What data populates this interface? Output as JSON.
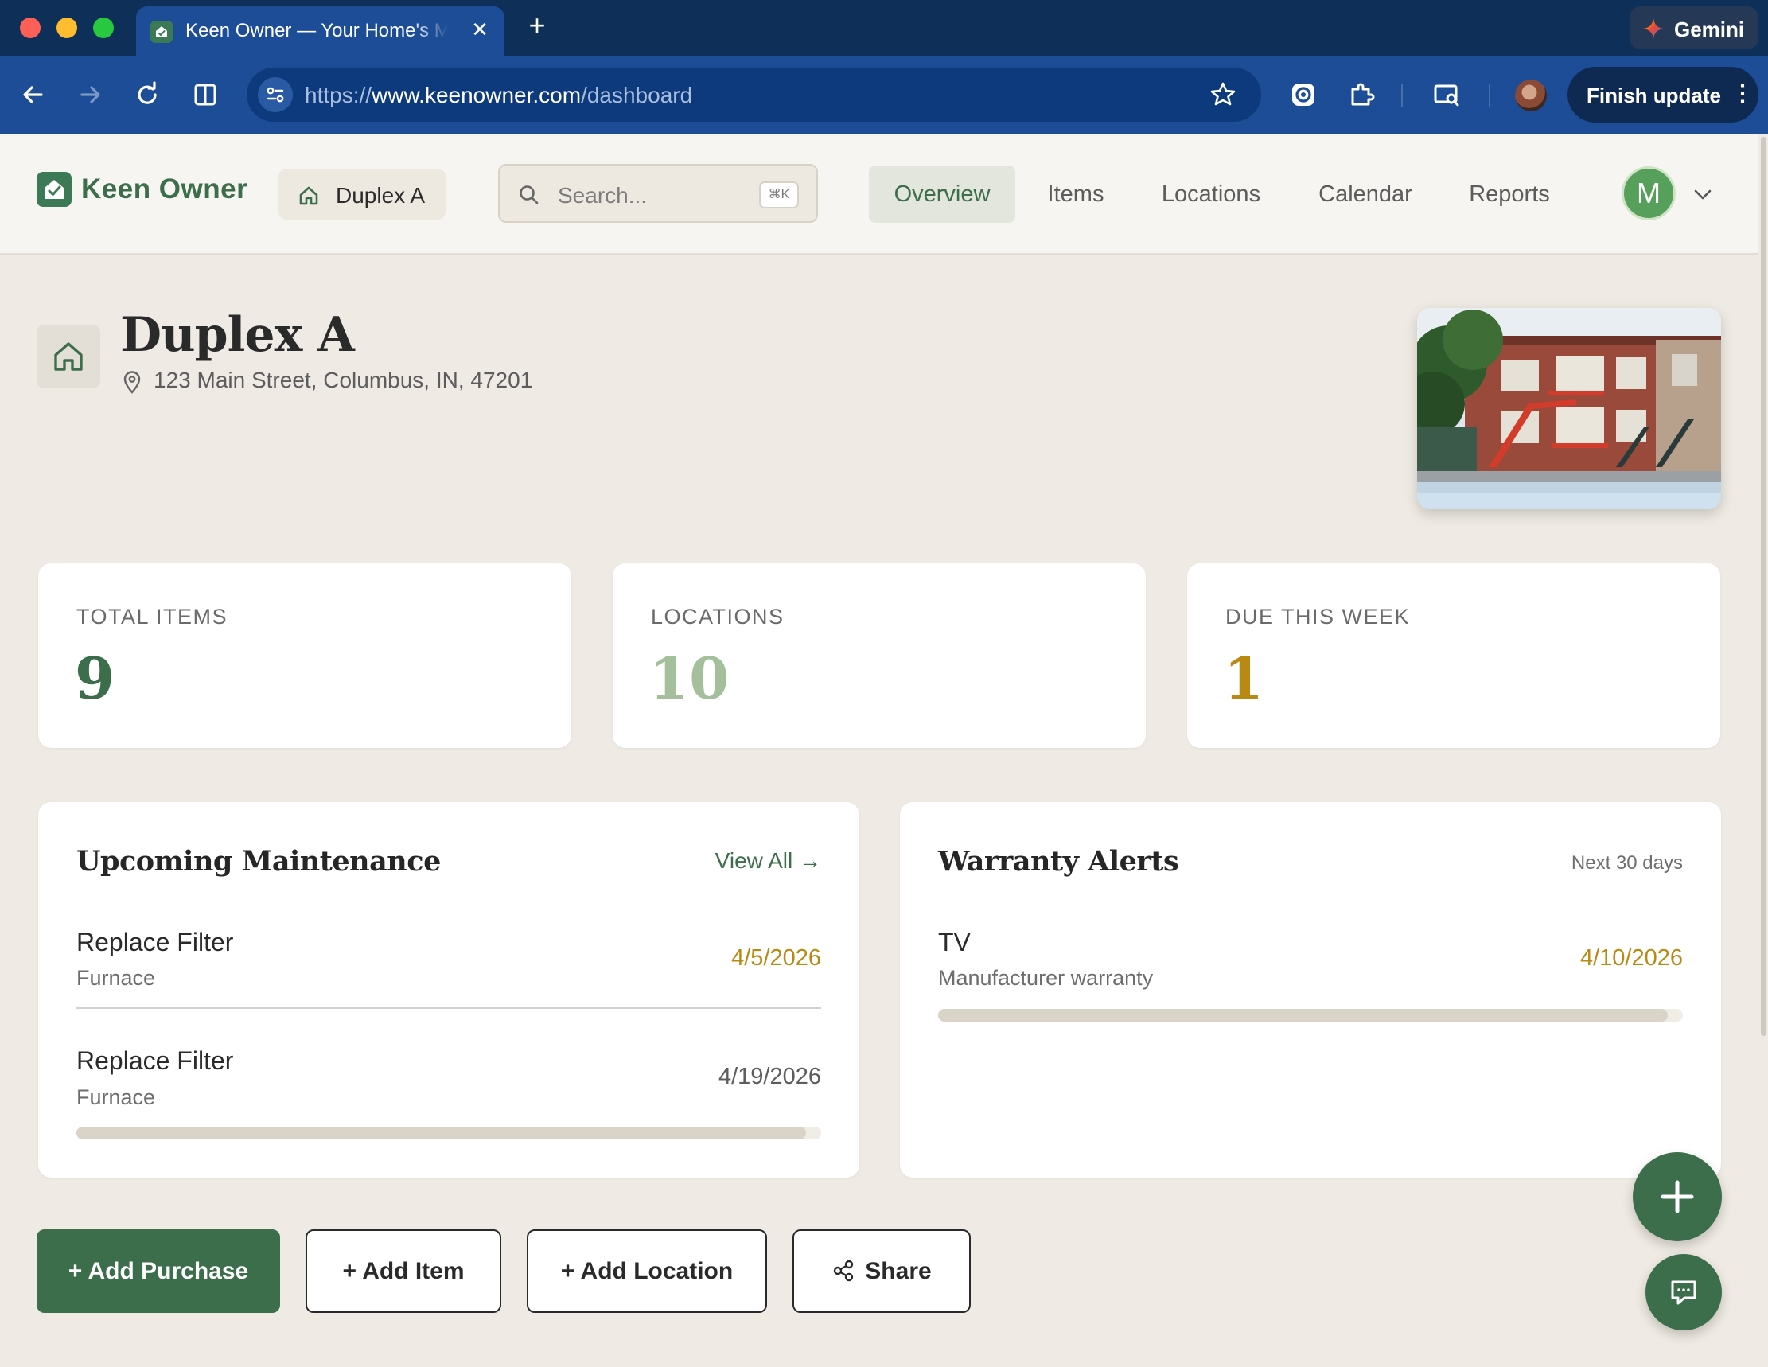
{
  "browser": {
    "tab_title": "Keen Owner — Your Home's Maintenance",
    "tab_close": "✕",
    "new_tab": "+",
    "gemini_label": "Gemini",
    "url_scheme": "https://",
    "url_host": "www.keenowner.com",
    "url_path": "/dashboard",
    "finish_update_label": "Finish update",
    "more_glyph": "⋮"
  },
  "header": {
    "brand": "Keen Owner",
    "property_chip": "Duplex A",
    "search_placeholder": "Search...",
    "search_shortcut": "⌘K",
    "nav": [
      {
        "label": "Overview",
        "active": true
      },
      {
        "label": "Items",
        "active": false
      },
      {
        "label": "Locations",
        "active": false
      },
      {
        "label": "Calendar",
        "active": false
      },
      {
        "label": "Reports",
        "active": false
      }
    ],
    "avatar_initial": "M"
  },
  "property": {
    "name": "Duplex A",
    "address": "123 Main Street, Columbus, IN, 47201"
  },
  "stats": [
    {
      "label": "TOTAL ITEMS",
      "value": "9",
      "color": "#3c6e4c"
    },
    {
      "label": "LOCATIONS",
      "value": "10",
      "color": "#a3bf9b"
    },
    {
      "label": "DUE THIS WEEK",
      "value": "1",
      "color": "#b88a14"
    }
  ],
  "maintenance": {
    "title": "Upcoming Maintenance",
    "view_all": "View All →",
    "items": [
      {
        "title": "Replace Filter",
        "subtitle": "Furnace",
        "date": "4/5/2026",
        "date_color": "#b88a14"
      },
      {
        "title": "Replace Filter",
        "subtitle": "Furnace",
        "date": "4/19/2026",
        "date_color": "#5d5d5d"
      }
    ],
    "scroll_fraction": 0.98
  },
  "warranty": {
    "title": "Warranty Alerts",
    "meta": "Next 30 days",
    "items": [
      {
        "title": "TV",
        "subtitle": "Manufacturer warranty",
        "date": "4/10/2026",
        "date_color": "#b88a14",
        "scroll_fraction": 0.98
      }
    ]
  },
  "actions": {
    "add_purchase": "+ Add Purchase",
    "add_item": "+ Add Item",
    "add_location": "+ Add Location",
    "share": "Share"
  },
  "colors": {
    "brand_green": "#3c6e4c",
    "gold": "#b88a14",
    "page_bg": "#efeae3"
  }
}
